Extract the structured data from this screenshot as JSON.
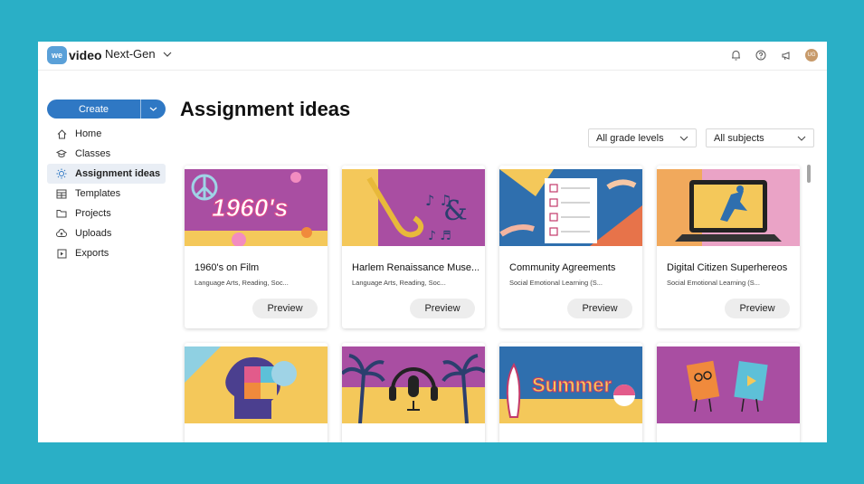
{
  "app": {
    "logo_badge": "we",
    "logo_text": "video",
    "workspace": "Next-Gen",
    "avatar_initials": "UG"
  },
  "sidebar": {
    "create_label": "Create",
    "items": [
      {
        "label": "Home",
        "icon": "home-icon"
      },
      {
        "label": "Classes",
        "icon": "graduation-cap-icon"
      },
      {
        "label": "Assignment ideas",
        "icon": "lightbulb-icon",
        "active": true
      },
      {
        "label": "Templates",
        "icon": "templates-icon"
      },
      {
        "label": "Projects",
        "icon": "folder-icon"
      },
      {
        "label": "Uploads",
        "icon": "cloud-upload-icon"
      },
      {
        "label": "Exports",
        "icon": "export-icon"
      }
    ]
  },
  "main": {
    "title": "Assignment ideas",
    "filters": [
      "All grade levels",
      "All subjects"
    ],
    "preview_label": "Preview",
    "cards": [
      {
        "title": "1960's on Film",
        "subtitle": "Language Arts, Reading, Soc...",
        "thumb_text": "1960's"
      },
      {
        "title": "Harlem Renaissance Muse...",
        "subtitle": "Language Arts, Reading, Soc..."
      },
      {
        "title": "Community Agreements",
        "subtitle": "Social Emotional Learning (S..."
      },
      {
        "title": "Digital Citizen Superhereos",
        "subtitle": "Social Emotional Learning (S..."
      },
      {
        "title": "",
        "subtitle": ""
      },
      {
        "title": "",
        "subtitle": ""
      },
      {
        "title": "",
        "subtitle": "",
        "thumb_text": "Summer"
      },
      {
        "title": "",
        "subtitle": ""
      }
    ]
  },
  "colors": {
    "background": "#2aafc6",
    "accent": "#2f78c4",
    "thumb_purple": "#a94ea2",
    "thumb_yellow": "#f4c85a"
  }
}
